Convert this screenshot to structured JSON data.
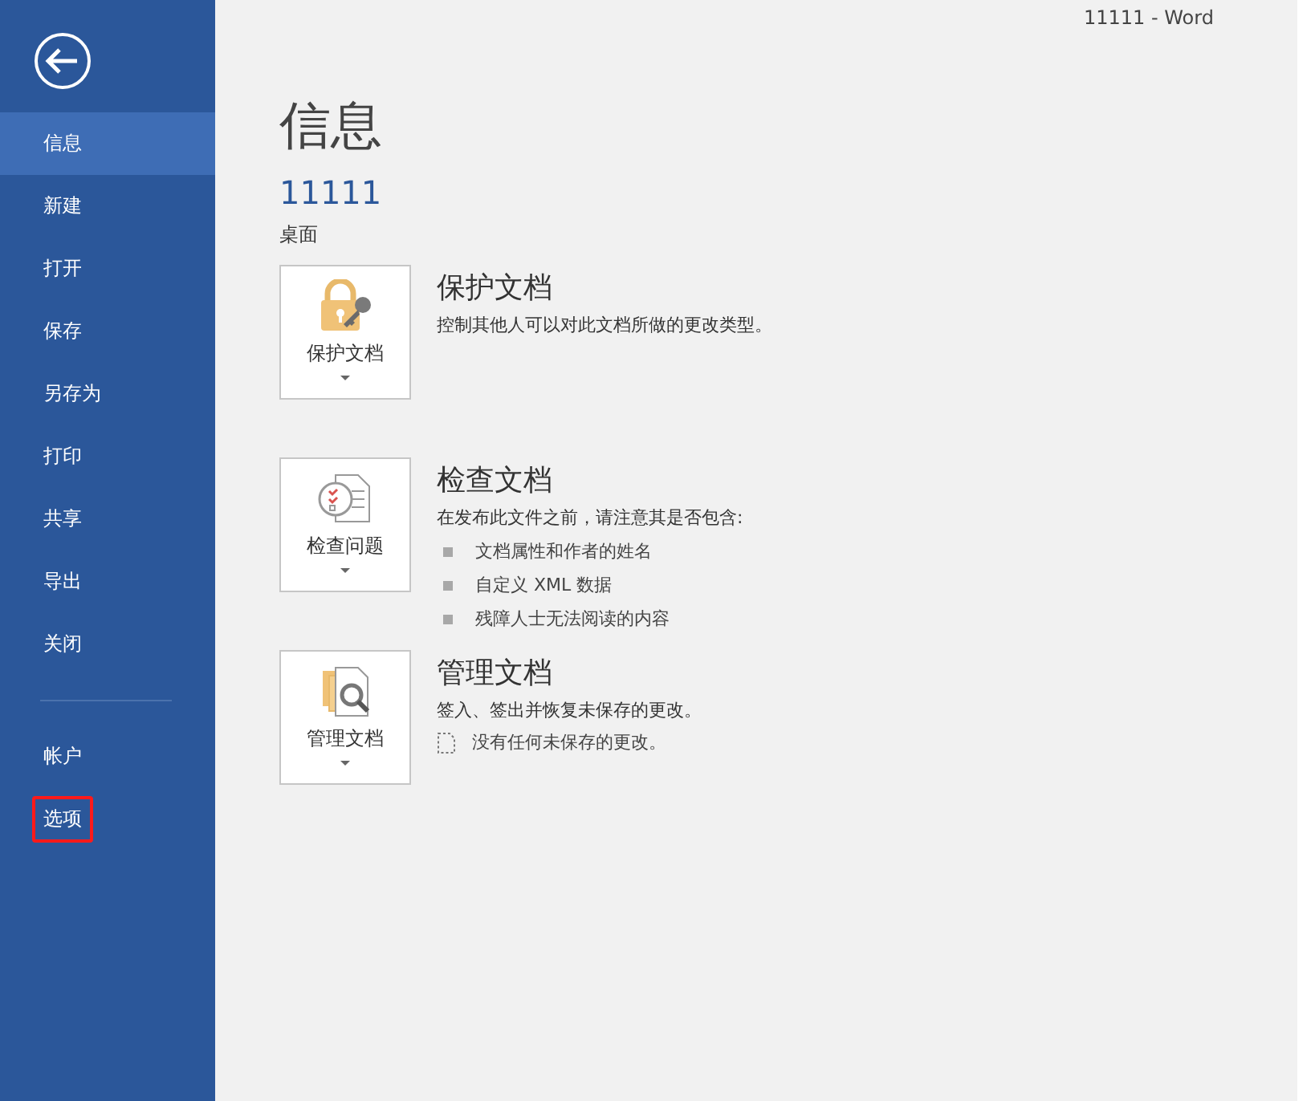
{
  "window": {
    "title": "11111 - Word"
  },
  "sidebar": {
    "items": [
      {
        "label": "信息",
        "selected": true,
        "highlighted": false
      },
      {
        "label": "新建",
        "selected": false,
        "highlighted": false
      },
      {
        "label": "打开",
        "selected": false,
        "highlighted": false
      },
      {
        "label": "保存",
        "selected": false,
        "highlighted": false
      },
      {
        "label": "另存为",
        "selected": false,
        "highlighted": false
      },
      {
        "label": "打印",
        "selected": false,
        "highlighted": false
      },
      {
        "label": "共享",
        "selected": false,
        "highlighted": false
      },
      {
        "label": "导出",
        "selected": false,
        "highlighted": false
      },
      {
        "label": "关闭",
        "selected": false,
        "highlighted": false
      }
    ],
    "bottom_items": [
      {
        "label": "帐户",
        "selected": false,
        "highlighted": false
      },
      {
        "label": "选项",
        "selected": false,
        "highlighted": true
      }
    ]
  },
  "page": {
    "heading": "信息",
    "document_name": "11111",
    "location": "桌面"
  },
  "sections": [
    {
      "kind": "protect",
      "button": "保护文档",
      "title": "保护文档",
      "description": "控制其他人可以对此文档所做的更改类型。"
    },
    {
      "kind": "inspect",
      "button": "检查问题",
      "title": "检查文档",
      "description": "在发布此文件之前，请注意其是否包含:",
      "bullets": [
        "文档属性和作者的姓名",
        "自定义 XML 数据",
        "残障人士无法阅读的内容"
      ]
    },
    {
      "kind": "manage",
      "button": "管理文档",
      "title": "管理文档",
      "description": "签入、签出并恢复未保存的更改。",
      "note": "没有任何未保存的更改。"
    }
  ]
}
